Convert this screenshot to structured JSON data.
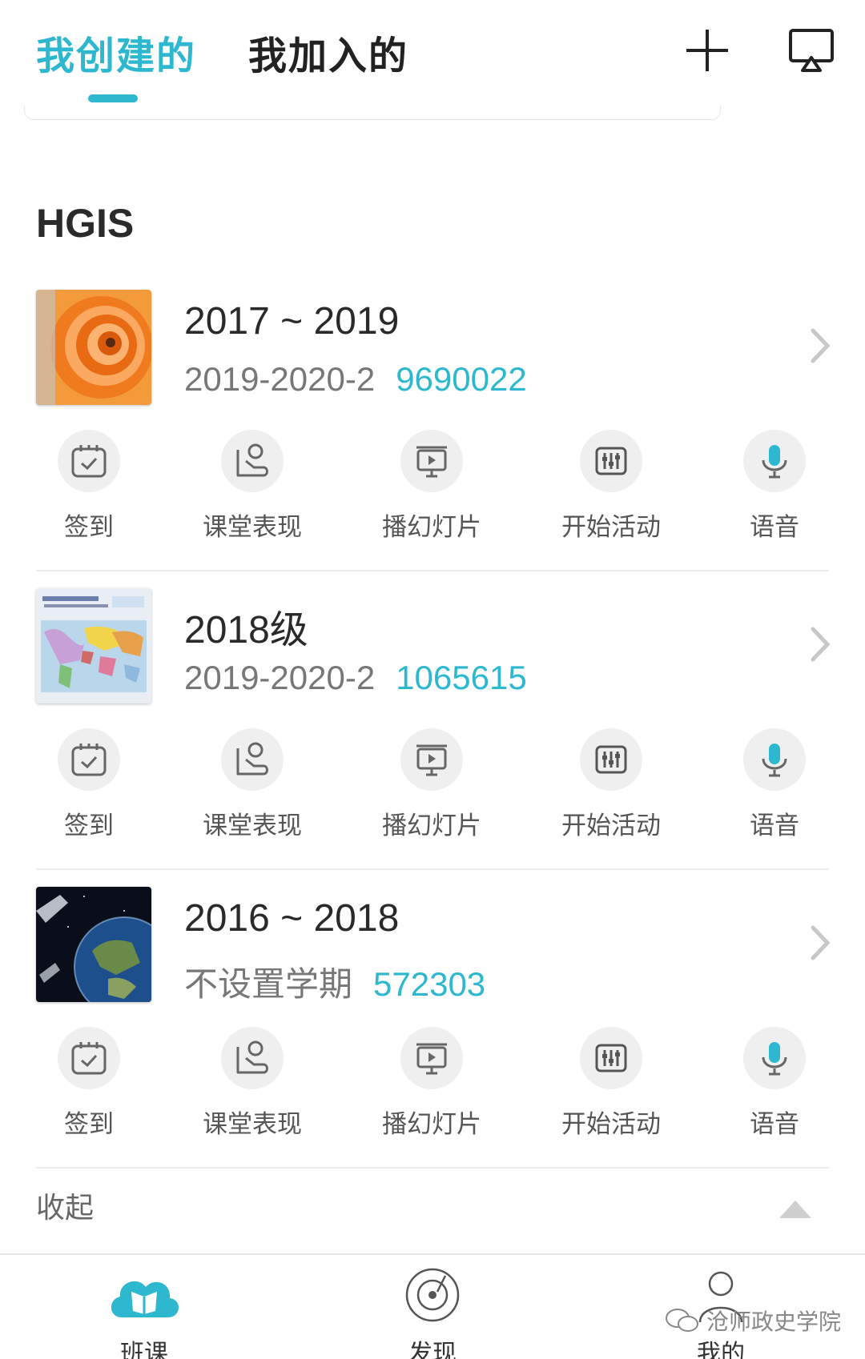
{
  "top_tabs": {
    "created": "我创建的",
    "joined": "我加入的"
  },
  "colors": {
    "accent": "#2db8d0",
    "muted": "#777777"
  },
  "icons": {
    "add": "plus-icon",
    "cast": "screen-cast-icon"
  },
  "group": {
    "title": "HGIS"
  },
  "courses": [
    {
      "title": "2017 ~ 2019",
      "term": "2019-2020-2",
      "code": "9690022",
      "thumb": "orange-spiral"
    },
    {
      "title": "2018级",
      "term": "2019-2020-2",
      "code": "1065615",
      "thumb": "world-map"
    },
    {
      "title": "2016 ~ 2018",
      "term": "不设置学期",
      "code": "572303",
      "thumb": "globe-satellite"
    }
  ],
  "actions": {
    "checkin": "签到",
    "performance": "课堂表现",
    "slides": "播幻灯片",
    "activity": "开始活动",
    "voice": "语音"
  },
  "collapse": {
    "label": "收起"
  },
  "bottom_nav": {
    "classes": "班课",
    "discover": "发现",
    "mine": "我的"
  },
  "watermark": {
    "text": "沧师政史学院"
  }
}
